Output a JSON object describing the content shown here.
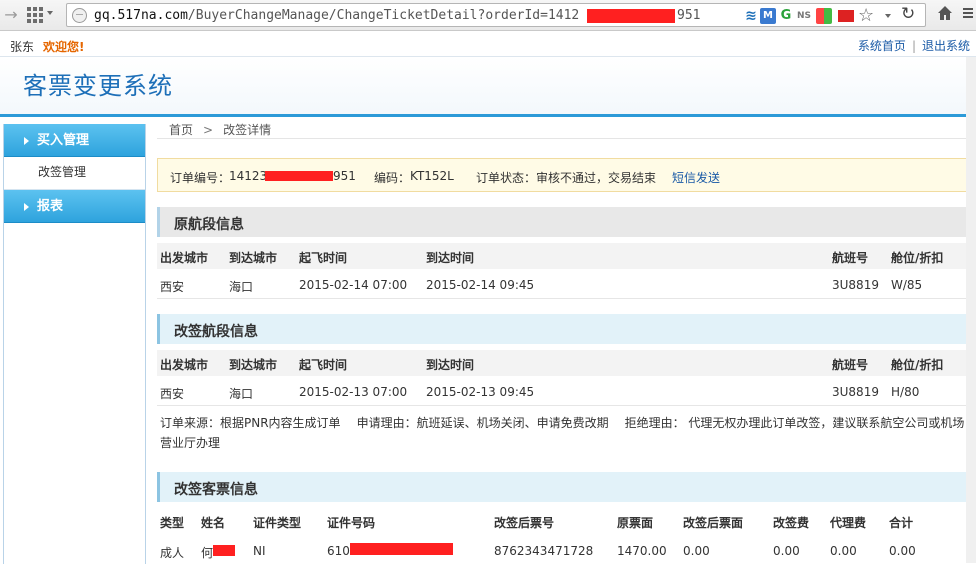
{
  "browser": {
    "url_host": "gq.517na.com",
    "url_path": "/BuyerChangeManage/ChangeTicketDetail?orderId=1412",
    "url_tail": "951"
  },
  "topbar": {
    "username": "张东",
    "welcome": "欢迎您!",
    "home_link": "系统首页",
    "logout_link": "退出系统"
  },
  "banner": {
    "title": "客票变更系统"
  },
  "sidebar": {
    "items": [
      {
        "label": "买入管理",
        "type": "head"
      },
      {
        "label": "改签管理",
        "type": "item"
      },
      {
        "label": "报表",
        "type": "head"
      }
    ]
  },
  "breadcrumb": {
    "home": "首页",
    "sep": ">",
    "current": "改签详情"
  },
  "order": {
    "number_label": "订单编号：",
    "number_prefix": "14123",
    "number_suffix": "951",
    "code_label": "编码：",
    "code": "KT152L",
    "status_label": "订单状态：",
    "status": "审核不通过，交易结束",
    "sms_link": "短信发送"
  },
  "original_segment": {
    "title": "原航段信息",
    "headers": [
      "出发城市",
      "到达城市",
      "起飞时间",
      "到达时间",
      "航班号",
      "舱位/折扣"
    ],
    "row": [
      "西安",
      "海口",
      "2015-02-14 07:00",
      "2015-02-14 09:45",
      "3U8819",
      "W/85"
    ]
  },
  "changed_segment": {
    "title": "改签航段信息",
    "headers": [
      "出发城市",
      "到达城市",
      "起飞时间",
      "到达时间",
      "航班号",
      "舱位/折扣"
    ],
    "row": [
      "西安",
      "海口",
      "2015-02-13 07:00",
      "2015-02-13 09:45",
      "3U8819",
      "H/80"
    ]
  },
  "reasons": {
    "source": "订单来源：根据PNR内容生成订单",
    "apply": "申请理由：航班延误、机场关闭、申请免费改期",
    "reject": "拒绝理由： 代理无权办理此订单改签，建议联系航空公司或机场营业厅办理"
  },
  "ticket_info": {
    "title": "改签客票信息",
    "headers": [
      "类型",
      "姓名",
      "证件类型",
      "证件号码",
      "改签后票号",
      "原票面",
      "改签后票面",
      "改签费",
      "代理费",
      "合计"
    ],
    "row": [
      "成人",
      "何",
      "NI",
      "610",
      "8762343471728",
      "1470.00",
      "0.00",
      "0.00",
      "0.00",
      "0.00"
    ]
  },
  "colors": {
    "accent": "#2ea3dd",
    "title": "#1d6fb8",
    "link": "#1a5aa6",
    "welcome": "#e56600",
    "redaction": "#ff2020"
  },
  "icons": [
    "back-arrow-icon",
    "apps-grid-icon",
    "globe-icon",
    "star-icon",
    "reload-icon",
    "home-icon",
    "menu-icon"
  ]
}
